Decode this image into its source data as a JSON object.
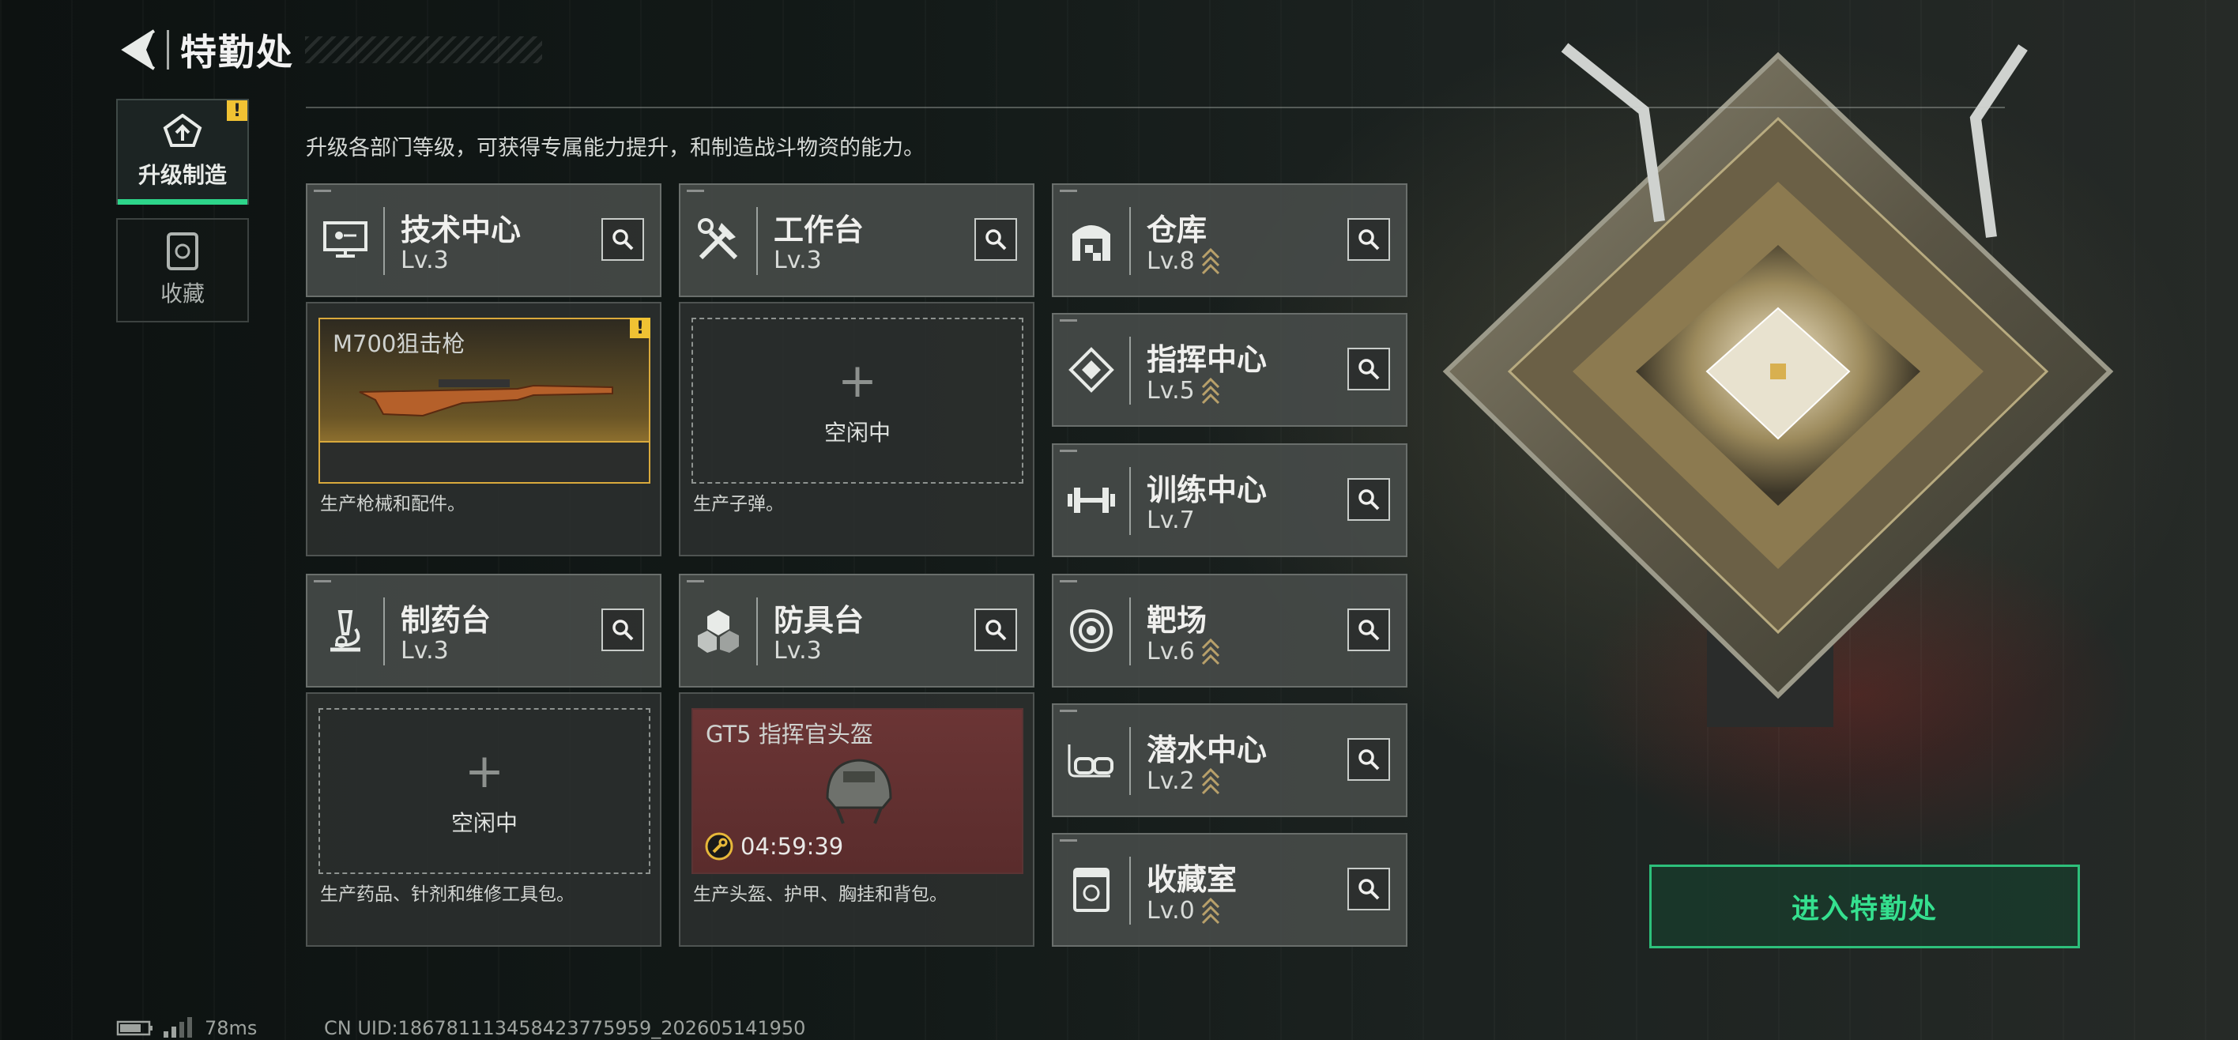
{
  "header": {
    "title": "特勤处"
  },
  "nav": [
    {
      "label": "升级制造",
      "badge": "!"
    },
    {
      "label": "收藏"
    }
  ],
  "description": "升级各部门等级，可获得专属能力提升，和制造战斗物资的能力。",
  "departments": {
    "tech": {
      "name": "技术中心",
      "level": "Lv.3"
    },
    "workbench": {
      "name": "工作台",
      "level": "Lv.3"
    },
    "warehouse": {
      "name": "仓库",
      "level": "Lv.8"
    },
    "command": {
      "name": "指挥中心",
      "level": "Lv.5"
    },
    "training": {
      "name": "训练中心",
      "level": "Lv.7"
    },
    "pharmacy": {
      "name": "制药台",
      "level": "Lv.3"
    },
    "armor": {
      "name": "防具台",
      "level": "Lv.3"
    },
    "range": {
      "name": "靶场",
      "level": "Lv.6"
    },
    "diving": {
      "name": "潜水中心",
      "level": "Lv.2"
    },
    "collection": {
      "name": "收藏室",
      "level": "Lv.0"
    }
  },
  "production": {
    "tech": {
      "item": "M700狙击枪",
      "badge": "!",
      "desc": "生产枪械和配件。"
    },
    "workbench": {
      "status": "空闲中",
      "desc": "生产子弹。"
    },
    "pharmacy": {
      "status": "空闲中",
      "desc": "生产药品、针剂和维修工具包。"
    },
    "armor": {
      "item": "GT5 指挥官头盔",
      "timer": "04:59:39",
      "desc": "生产头盔、护甲、胸挂和背包。"
    }
  },
  "enter_button": "进入特勤处",
  "status_bar": {
    "ping": "78ms",
    "uid": "CN UID:1867811134584237759​59_202605141950"
  },
  "colors": {
    "accent": "#2dd58a",
    "warning": "#f0c233",
    "rifle_border": "#d9a93c"
  }
}
